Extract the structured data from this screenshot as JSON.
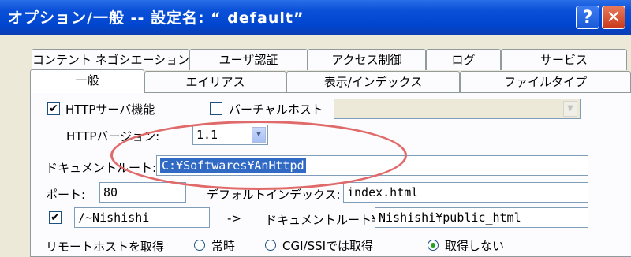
{
  "window": {
    "title": "オプション/一般 -- 設定名: “ default”",
    "help_label": "?",
    "close_label": "✕"
  },
  "tabs_row1": [
    "コンテント ネゴシエーション",
    "ユーザ認証",
    "アクセス制御",
    "ログ",
    "サービス"
  ],
  "tabs_row2": [
    "一般",
    "エイリアス",
    "表示/インデックス",
    "ファイルタイプ"
  ],
  "form": {
    "http_server_label": "HTTPサーバ機能",
    "http_server_checked": "✔",
    "virtual_host_label": "バーチャルホスト",
    "virtual_host_value": "",
    "http_version_label": "HTTPバージョン:",
    "http_version_value": "1.1",
    "doc_root_label": "ドキュメントルート:",
    "doc_root_value": "C:¥Softwares¥AnHttpd",
    "port_label": "ポート:",
    "port_value": "80",
    "default_index_label": "デフォルトインデックス:",
    "default_index_value": "index.html",
    "user_checked": "✔",
    "user_path_value": "/~Nishishi",
    "arrow_label": "->",
    "user_doc_root_label": "ドキュメントルート¥",
    "user_doc_root_value": "Nishishi¥public_html",
    "remote_host_label": "リモートホストを取得",
    "radio_always": "常時",
    "radio_cgi": "CGI/SSIでは取得",
    "radio_never": "取得しない"
  },
  "icons": {
    "dropdown": "▼"
  },
  "colors": {
    "titlebar": "#0046cf",
    "selection": "#316ac5",
    "highlight_ellipse": "#e06a6a"
  }
}
